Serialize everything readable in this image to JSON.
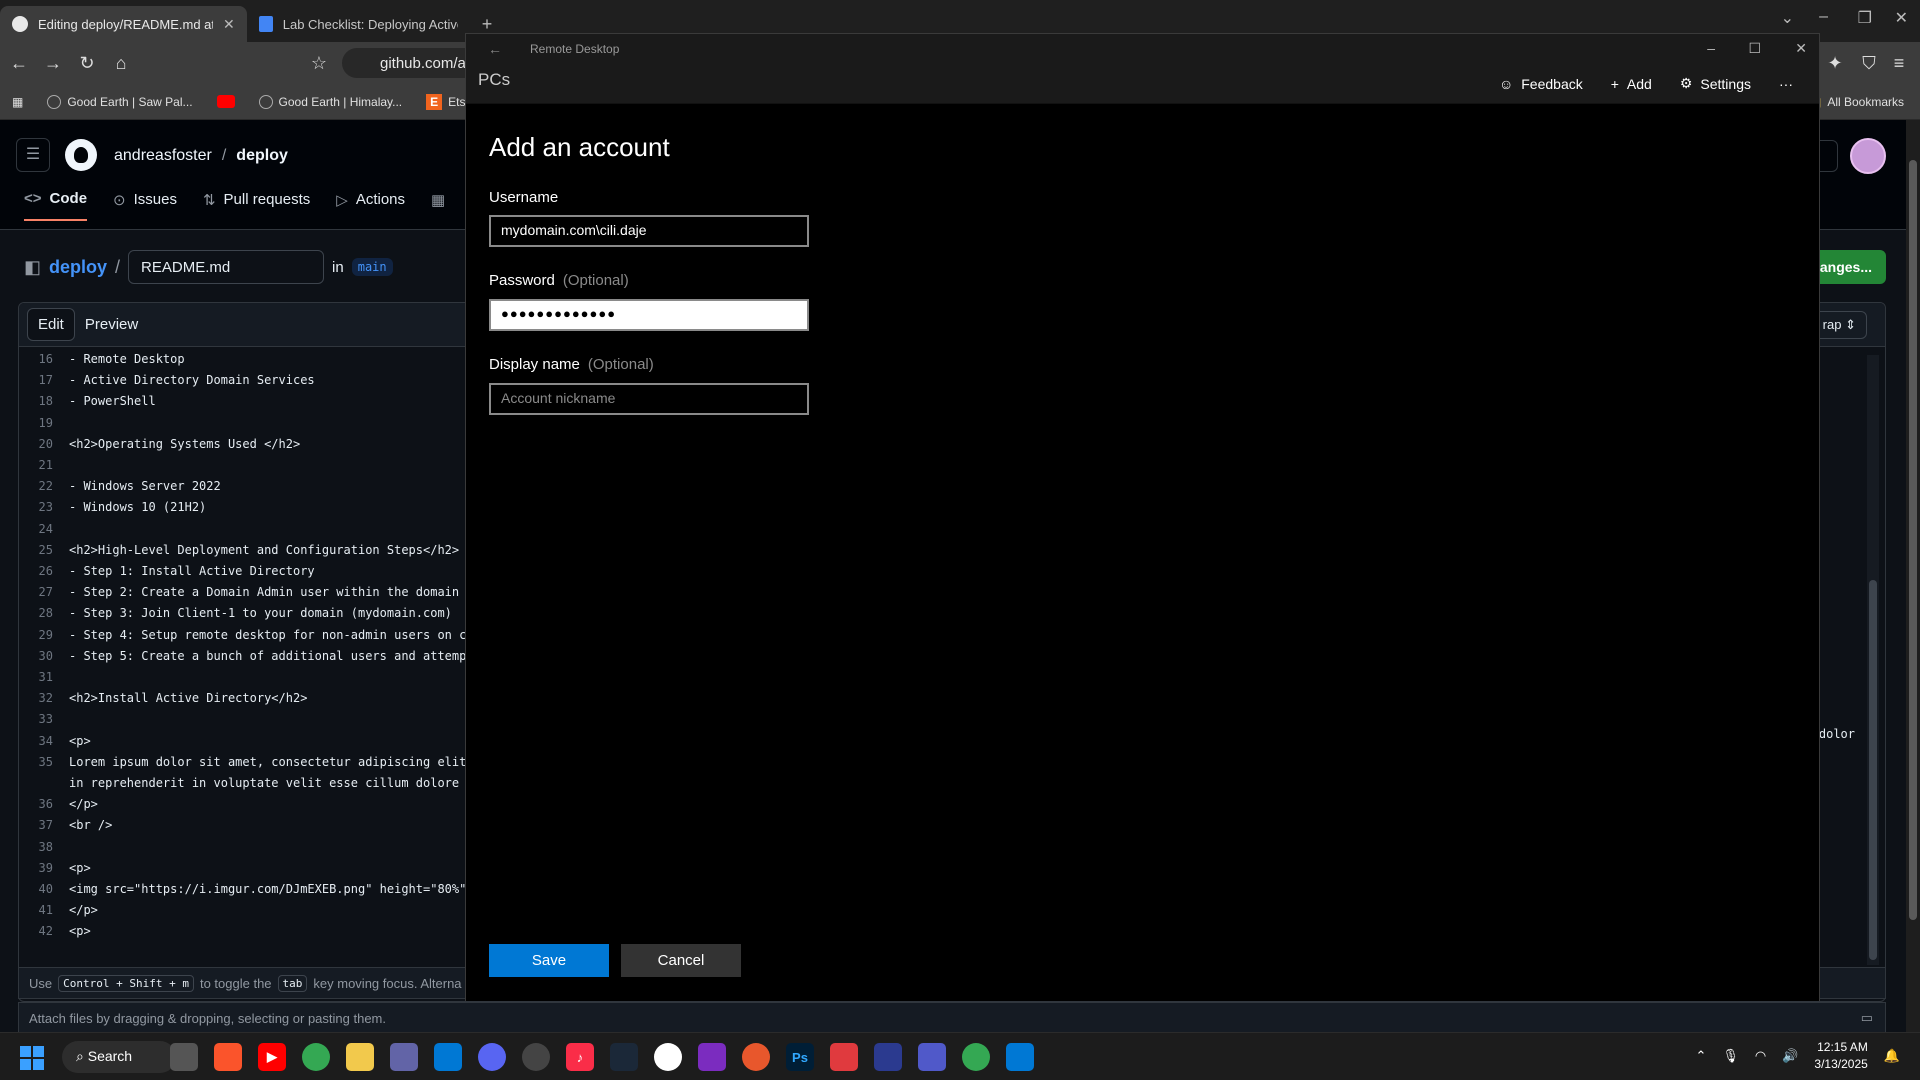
{
  "browser": {
    "tabs": [
      {
        "label": "Editing deploy/README.md at main",
        "active": true
      },
      {
        "label": "Lab Checklist: Deploying Active Directory",
        "active": false
      }
    ],
    "url": "github.com/a",
    "bookmarks": [
      "Good Earth | Saw Pal...",
      "Good Earth | Himalay...",
      "Ets"
    ],
    "all_bookmarks": "All Bookmarks"
  },
  "github": {
    "owner": "andreasfoster",
    "repo": "deploy",
    "nav": [
      "Code",
      "Issues",
      "Pull requests",
      "Actions"
    ],
    "edit_repo": "deploy",
    "filename": "README.md",
    "in_label": "in",
    "branch": "main",
    "commit_button": "anges...",
    "edit_tab": "Edit",
    "preview_tab": "Preview",
    "wrap_label": "rap",
    "code_lines": [
      {
        "n": "16",
        "t": "- Remote Desktop"
      },
      {
        "n": "17",
        "t": "- Active Directory Domain Services"
      },
      {
        "n": "18",
        "t": "- PowerShell"
      },
      {
        "n": "19",
        "t": ""
      },
      {
        "n": "20",
        "t": "<h2>Operating Systems Used </h2>"
      },
      {
        "n": "21",
        "t": ""
      },
      {
        "n": "22",
        "t": "- Windows Server 2022"
      },
      {
        "n": "23",
        "t": "- Windows 10 (21H2)"
      },
      {
        "n": "24",
        "t": ""
      },
      {
        "n": "25",
        "t": "<h2>High-Level Deployment and Configuration Steps</h2>"
      },
      {
        "n": "26",
        "t": "- Step 1: Install Active Directory"
      },
      {
        "n": "27",
        "t": "- Step 2: Create a Domain Admin user within the domain"
      },
      {
        "n": "28",
        "t": "- Step 3: Join Client-1 to your domain (mydomain.com)"
      },
      {
        "n": "29",
        "t": "- Step 4: Setup remote desktop for non-admin users on c"
      },
      {
        "n": "30",
        "t": "- Step 5: Create a bunch of additional users and attemp"
      },
      {
        "n": "31",
        "t": ""
      },
      {
        "n": "32",
        "t": "<h2>Install Active Directory</h2>"
      },
      {
        "n": "33",
        "t": ""
      },
      {
        "n": "34",
        "t": "<p>"
      },
      {
        "n": "35",
        "t": "Lorem ipsum dolor sit amet, consectetur adipiscing elit"
      },
      {
        "n": "",
        "t": "in reprehenderit in voluptate velit esse cillum dolore"
      },
      {
        "n": "36",
        "t": "</p>"
      },
      {
        "n": "37",
        "t": "<br />"
      },
      {
        "n": "38",
        "t": ""
      },
      {
        "n": "39",
        "t": "<p>"
      },
      {
        "n": "40",
        "t": "<img src=\"https://i.imgur.com/DJmEXEB.png\" height=\"80%\""
      },
      {
        "n": "41",
        "t": "</p>"
      },
      {
        "n": "42",
        "t": "<p>"
      }
    ],
    "line35_tail": "dolor",
    "hint_use": "Use",
    "hint_keys": "Control + Shift + m",
    "hint_mid": "to toggle the",
    "hint_tab": "tab",
    "hint_end": "key moving focus. Alterna",
    "attach_text": "Attach files by dragging & dropping, selecting or pasting them."
  },
  "remote_desktop": {
    "window_title": "Remote Desktop",
    "section": "PCs",
    "actions": [
      "Feedback",
      "Add",
      "Settings"
    ],
    "heading": "Add an account",
    "username_label": "Username",
    "username_value": "mydomain.com\\cili.daje",
    "password_label": "Password",
    "password_optional": "(Optional)",
    "password_value": "●●●●●●●●●●●●●",
    "display_label": "Display name",
    "display_optional": "(Optional)",
    "display_placeholder": "Account nickname",
    "save": "Save",
    "cancel": "Cancel"
  },
  "taskbar": {
    "search": "Search",
    "time": "12:15 AM",
    "date": "3/13/2025"
  }
}
